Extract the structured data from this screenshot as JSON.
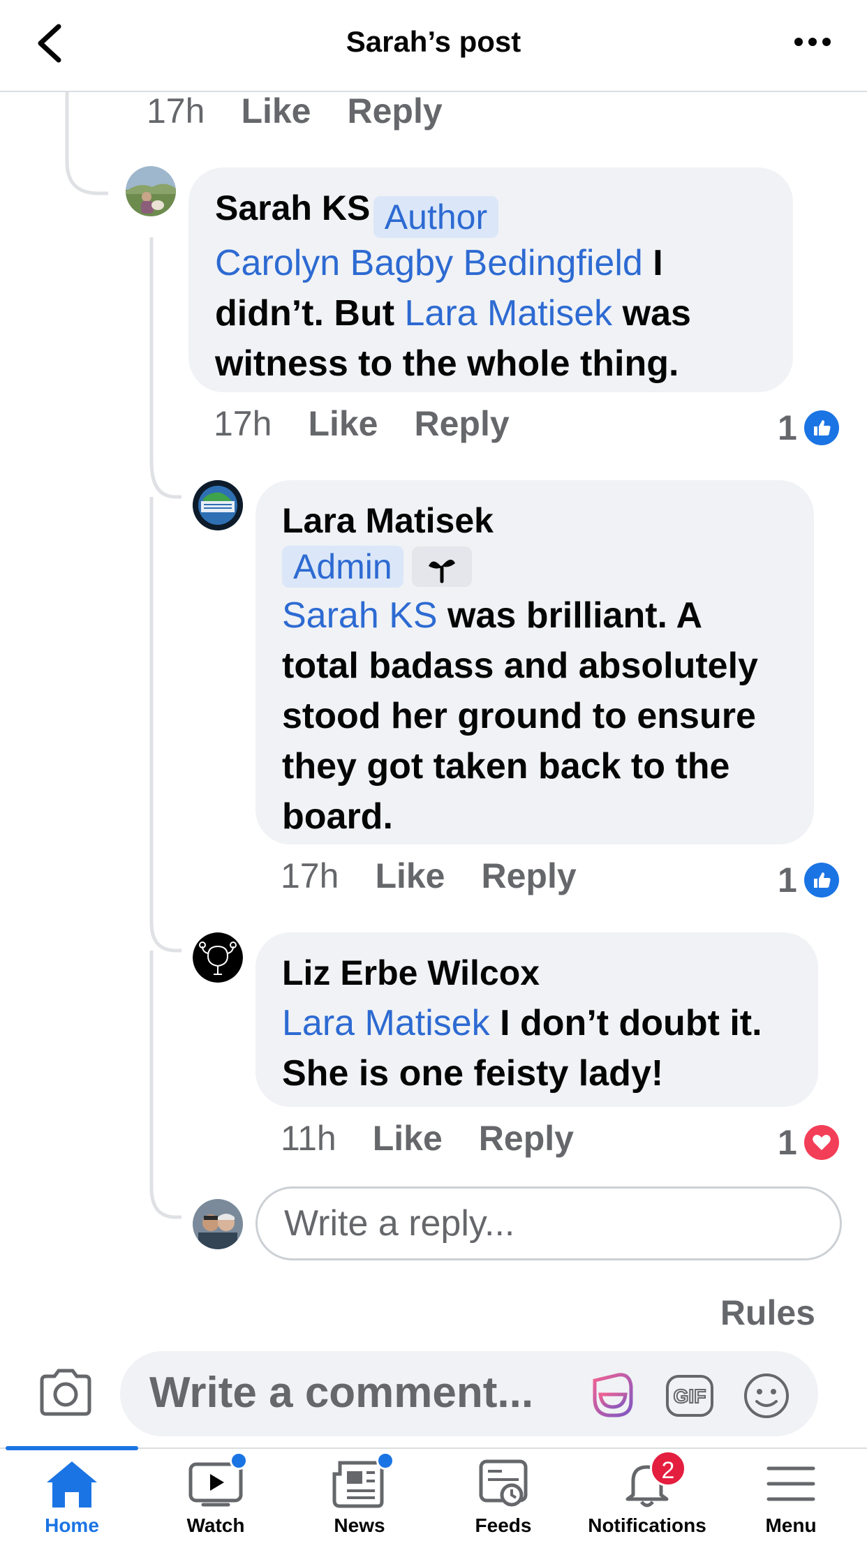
{
  "header": {
    "title": "Sarah’s post"
  },
  "top_meta": {
    "time": "17h",
    "like": "Like",
    "reply": "Reply"
  },
  "comments": [
    {
      "author": "Sarah KS",
      "badge": "Author",
      "mention1": "Carolyn Bagby Bedingfield",
      "text1": " I didn’t. But ",
      "mention2": "Lara Matisek",
      "text2": " was witness to the whole thing.",
      "time": "17h",
      "like": "Like",
      "reply": "Reply",
      "reaction_count": "1",
      "reaction_icon": "like-icon"
    },
    {
      "author": "Lara Matisek",
      "badge": "Admin",
      "secondary_badge_icon": "sprout-icon",
      "mention1": "Sarah KS",
      "text1": " was brilliant. A total badass and absolutely stood her ground to ensure they got taken back to the board.",
      "time": "17h",
      "like": "Like",
      "reply": "Reply",
      "reaction_count": "1",
      "reaction_icon": "like-icon"
    },
    {
      "author": "Liz Erbe Wilcox",
      "mention1": "Lara Matisek",
      "text1": " I don’t doubt it. She is one feisty lady!",
      "time": "11h",
      "like": "Like",
      "reply": "Reply",
      "reaction_count": "1",
      "reaction_icon": "love-icon"
    }
  ],
  "reply_input": {
    "placeholder": "Write a reply..."
  },
  "rules_label": "Rules",
  "comment_input": {
    "placeholder": "Write a comment..."
  },
  "tabs": [
    {
      "label": "Home",
      "icon": "home-icon",
      "active": true
    },
    {
      "label": "Watch",
      "icon": "watch-icon",
      "dot": true
    },
    {
      "label": "News",
      "icon": "news-icon",
      "dot": true
    },
    {
      "label": "Feeds",
      "icon": "feeds-icon"
    },
    {
      "label": "Notifications",
      "icon": "bell-icon",
      "badge": "2"
    },
    {
      "label": "Menu",
      "icon": "menu-icon"
    }
  ],
  "colors": {
    "accent": "#1b74e4",
    "mention": "#2d6ad2",
    "bubble": "#f0f2f5",
    "love": "#f33e58",
    "badge_red": "#e41e3f"
  }
}
